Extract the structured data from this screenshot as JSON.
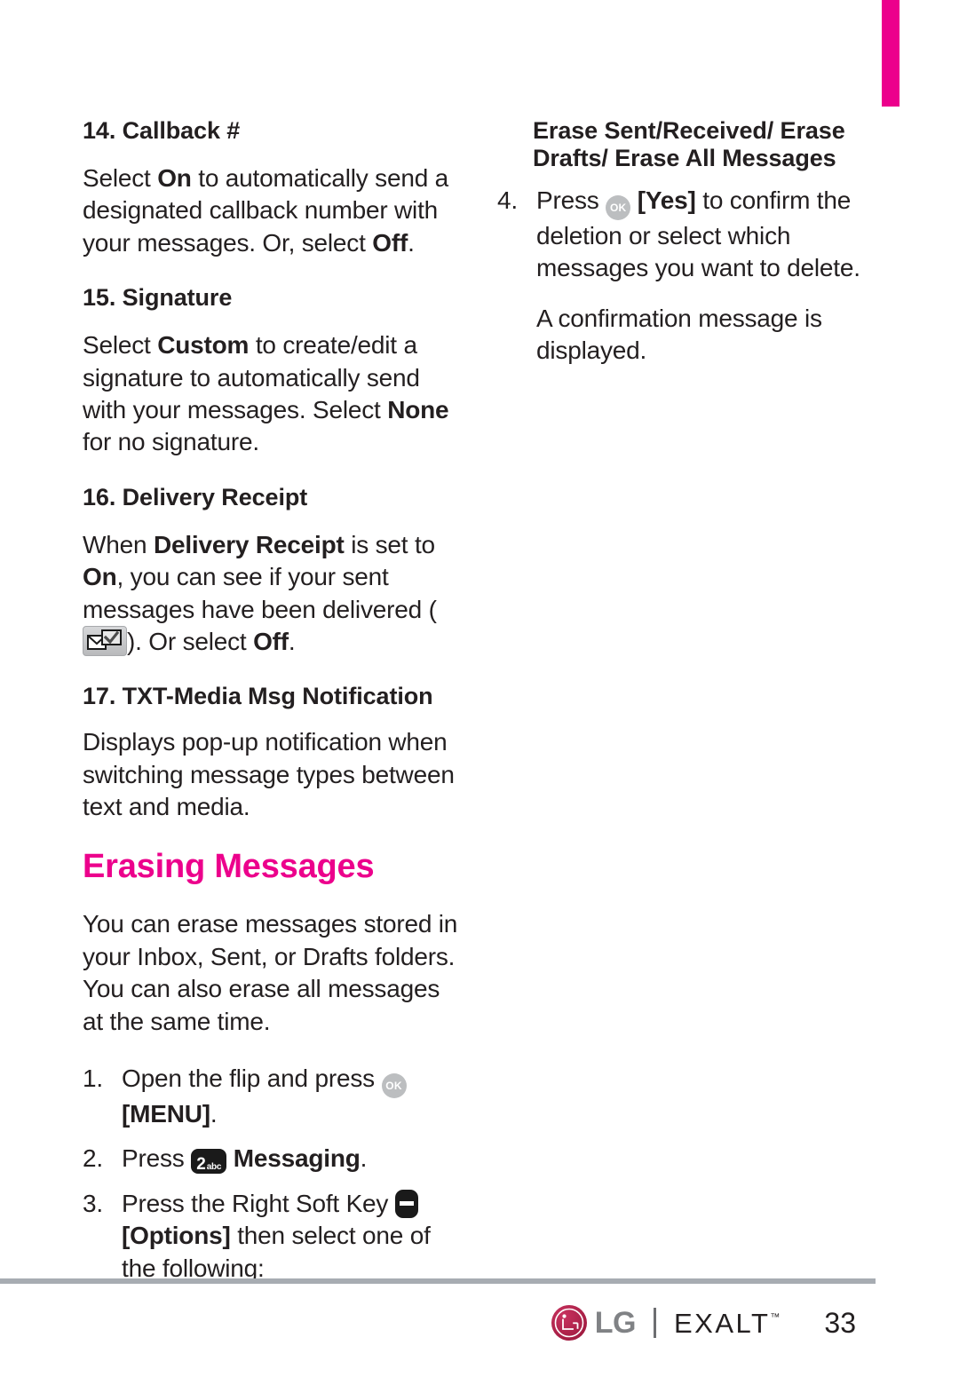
{
  "accent_color": "#ec008c",
  "left_column": {
    "section_14": {
      "heading": "14. Callback #",
      "body_1": "Select ",
      "bold_1": "On",
      "body_2": " to automatically send a designated callback number with your messages. Or, select ",
      "bold_2": "Off",
      "body_3": "."
    },
    "section_15": {
      "heading": "15. Signature",
      "body_1": "Select ",
      "bold_1": "Custom",
      "body_2": " to create/edit a signature to automatically send with your messages. Select ",
      "bold_2": "None",
      "body_3": " for no signature."
    },
    "section_16": {
      "heading": "16. Delivery Receipt",
      "body_1": "When ",
      "bold_1": "Delivery Receipt",
      "body_2": " is set to ",
      "bold_2": "On",
      "body_3": ", you can see if your sent messages have been delivered (",
      "icon": "delivery-receipt-icon",
      "body_4": "). Or select ",
      "bold_3": "Off",
      "body_4b": "."
    },
    "section_17": {
      "heading": "17. TXT-Media Msg Notification",
      "body": "Displays pop-up notification when switching message types between text and media."
    },
    "chapter": {
      "heading": "Erasing Messages",
      "intro": "You can erase messages stored in your Inbox, Sent, or Drafts folders. You can also erase all messages at the same time."
    },
    "steps": [
      {
        "num": "1.",
        "text_1": "Open the flip and press ",
        "icon": "ok-key-icon",
        "text_2": " ",
        "bold": "[MENU]",
        "text_3": "."
      },
      {
        "num": "2.",
        "text_1": "Press ",
        "icon": "key-2abc-icon",
        "key_big": "2",
        "key_small": "abc",
        "text_2": " ",
        "bold": "Messaging",
        "text_3": "."
      },
      {
        "num": "3.",
        "text_1": "Press the Right Soft Key ",
        "icon": "right-soft-key-icon",
        "text_2": " ",
        "bold": "[Options]",
        "text_3": " then select one of the following:"
      }
    ]
  },
  "right_column": {
    "heading": "Erase Sent/Received/ Erase Drafts/ Erase All Messages",
    "step_4": {
      "num": "4.",
      "text_1": "Press ",
      "icon": "ok-key-icon",
      "text_2": " ",
      "bold": "[Yes]",
      "text_3": " to confirm the deletion or select which messages you want to delete."
    },
    "note": "A confirmation message is displayed."
  },
  "footer": {
    "brand_lg": "LG",
    "brand_product": "EXALT",
    "trademark": "™",
    "page_number": "33"
  }
}
